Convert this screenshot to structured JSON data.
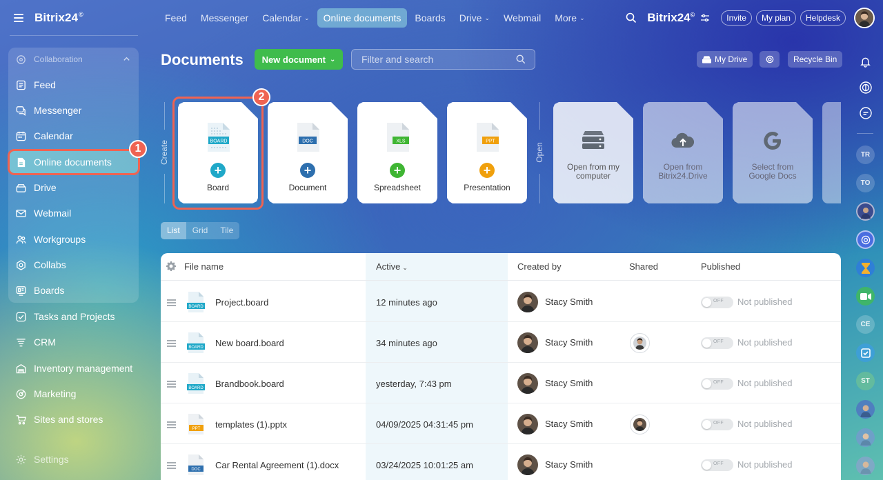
{
  "app": {
    "logo": "Bitrix24",
    "logo_mark": "©",
    "top_logo": "Bitrix24",
    "top_logo_mark": "©"
  },
  "sidebar": {
    "group_title": "Collaboration",
    "items": [
      {
        "label": "Feed"
      },
      {
        "label": "Messenger"
      },
      {
        "label": "Calendar"
      },
      {
        "label": "Online documents"
      },
      {
        "label": "Drive"
      },
      {
        "label": "Webmail"
      },
      {
        "label": "Workgroups"
      },
      {
        "label": "Collabs"
      },
      {
        "label": "Boards"
      },
      {
        "label": "Tasks and Projects"
      },
      {
        "label": "CRM"
      },
      {
        "label": "Inventory management"
      },
      {
        "label": "Marketing"
      },
      {
        "label": "Sites and stores"
      }
    ],
    "settings_label": "Settings"
  },
  "topnav": {
    "items": [
      {
        "label": "Feed"
      },
      {
        "label": "Messenger"
      },
      {
        "label": "Calendar"
      },
      {
        "label": "Online documents"
      },
      {
        "label": "Boards"
      },
      {
        "label": "Drive"
      },
      {
        "label": "Webmail"
      },
      {
        "label": "More"
      }
    ],
    "invite": "Invite",
    "my_plan": "My plan",
    "helpdesk": "Helpdesk"
  },
  "header": {
    "title": "Documents",
    "new_document": "New document",
    "filter_placeholder": "Filter and search",
    "my_drive": "My Drive",
    "recycle_bin": "Recycle Bin"
  },
  "create": {
    "section_label": "Create",
    "cards": [
      {
        "label": "Board",
        "tag": "BOARD",
        "color": "#1fa8c8"
      },
      {
        "label": "Document",
        "tag": "DOC",
        "color": "#2d6fae"
      },
      {
        "label": "Spreadsheet",
        "tag": "XLS",
        "color": "#3fb533"
      },
      {
        "label": "Presentation",
        "tag": "PPT",
        "color": "#f0a00c"
      }
    ]
  },
  "open": {
    "section_label": "Open",
    "cards": [
      {
        "label": "Open from my computer"
      },
      {
        "label": "Open from Bitrix24.Drive"
      },
      {
        "label": "Select from Google Docs"
      }
    ]
  },
  "annotations": {
    "one": "1",
    "two": "2"
  },
  "view": {
    "list": "List",
    "grid": "Grid",
    "tile": "Tile"
  },
  "table": {
    "columns": {
      "file_name": "File name",
      "active": "Active",
      "created_by": "Created by",
      "shared": "Shared",
      "published": "Published"
    },
    "toggle_off": "OFF",
    "rows": [
      {
        "name": "Project.board",
        "tag": "BOARD",
        "active": "12 minutes ago",
        "created_by": "Stacy Smith",
        "published": "Not published"
      },
      {
        "name": "New board.board",
        "tag": "BOARD",
        "active": "34 minutes ago",
        "created_by": "Stacy Smith",
        "published": "Not published"
      },
      {
        "name": "Brandbook.board",
        "tag": "BOARD",
        "active": "yesterday, 7:43 pm",
        "created_by": "Stacy Smith",
        "published": "Not published"
      },
      {
        "name": "templates (1).pptx",
        "tag": "PPT",
        "active": "04/09/2025 04:31:45 pm",
        "created_by": "Stacy Smith",
        "published": "Not published"
      },
      {
        "name": "Car Rental Agreement (1).docx",
        "tag": "DOC",
        "active": "03/24/2025 10:01:25 am",
        "created_by": "Stacy Smith",
        "published": "Not published"
      }
    ]
  },
  "rail": {
    "initials_tr": "TR",
    "initials_to": "TO",
    "initials_ce": "CE",
    "initials_st": "ST"
  },
  "colors": {
    "accent_green": "#3fbc4c",
    "highlight_red": "#ef6352"
  }
}
